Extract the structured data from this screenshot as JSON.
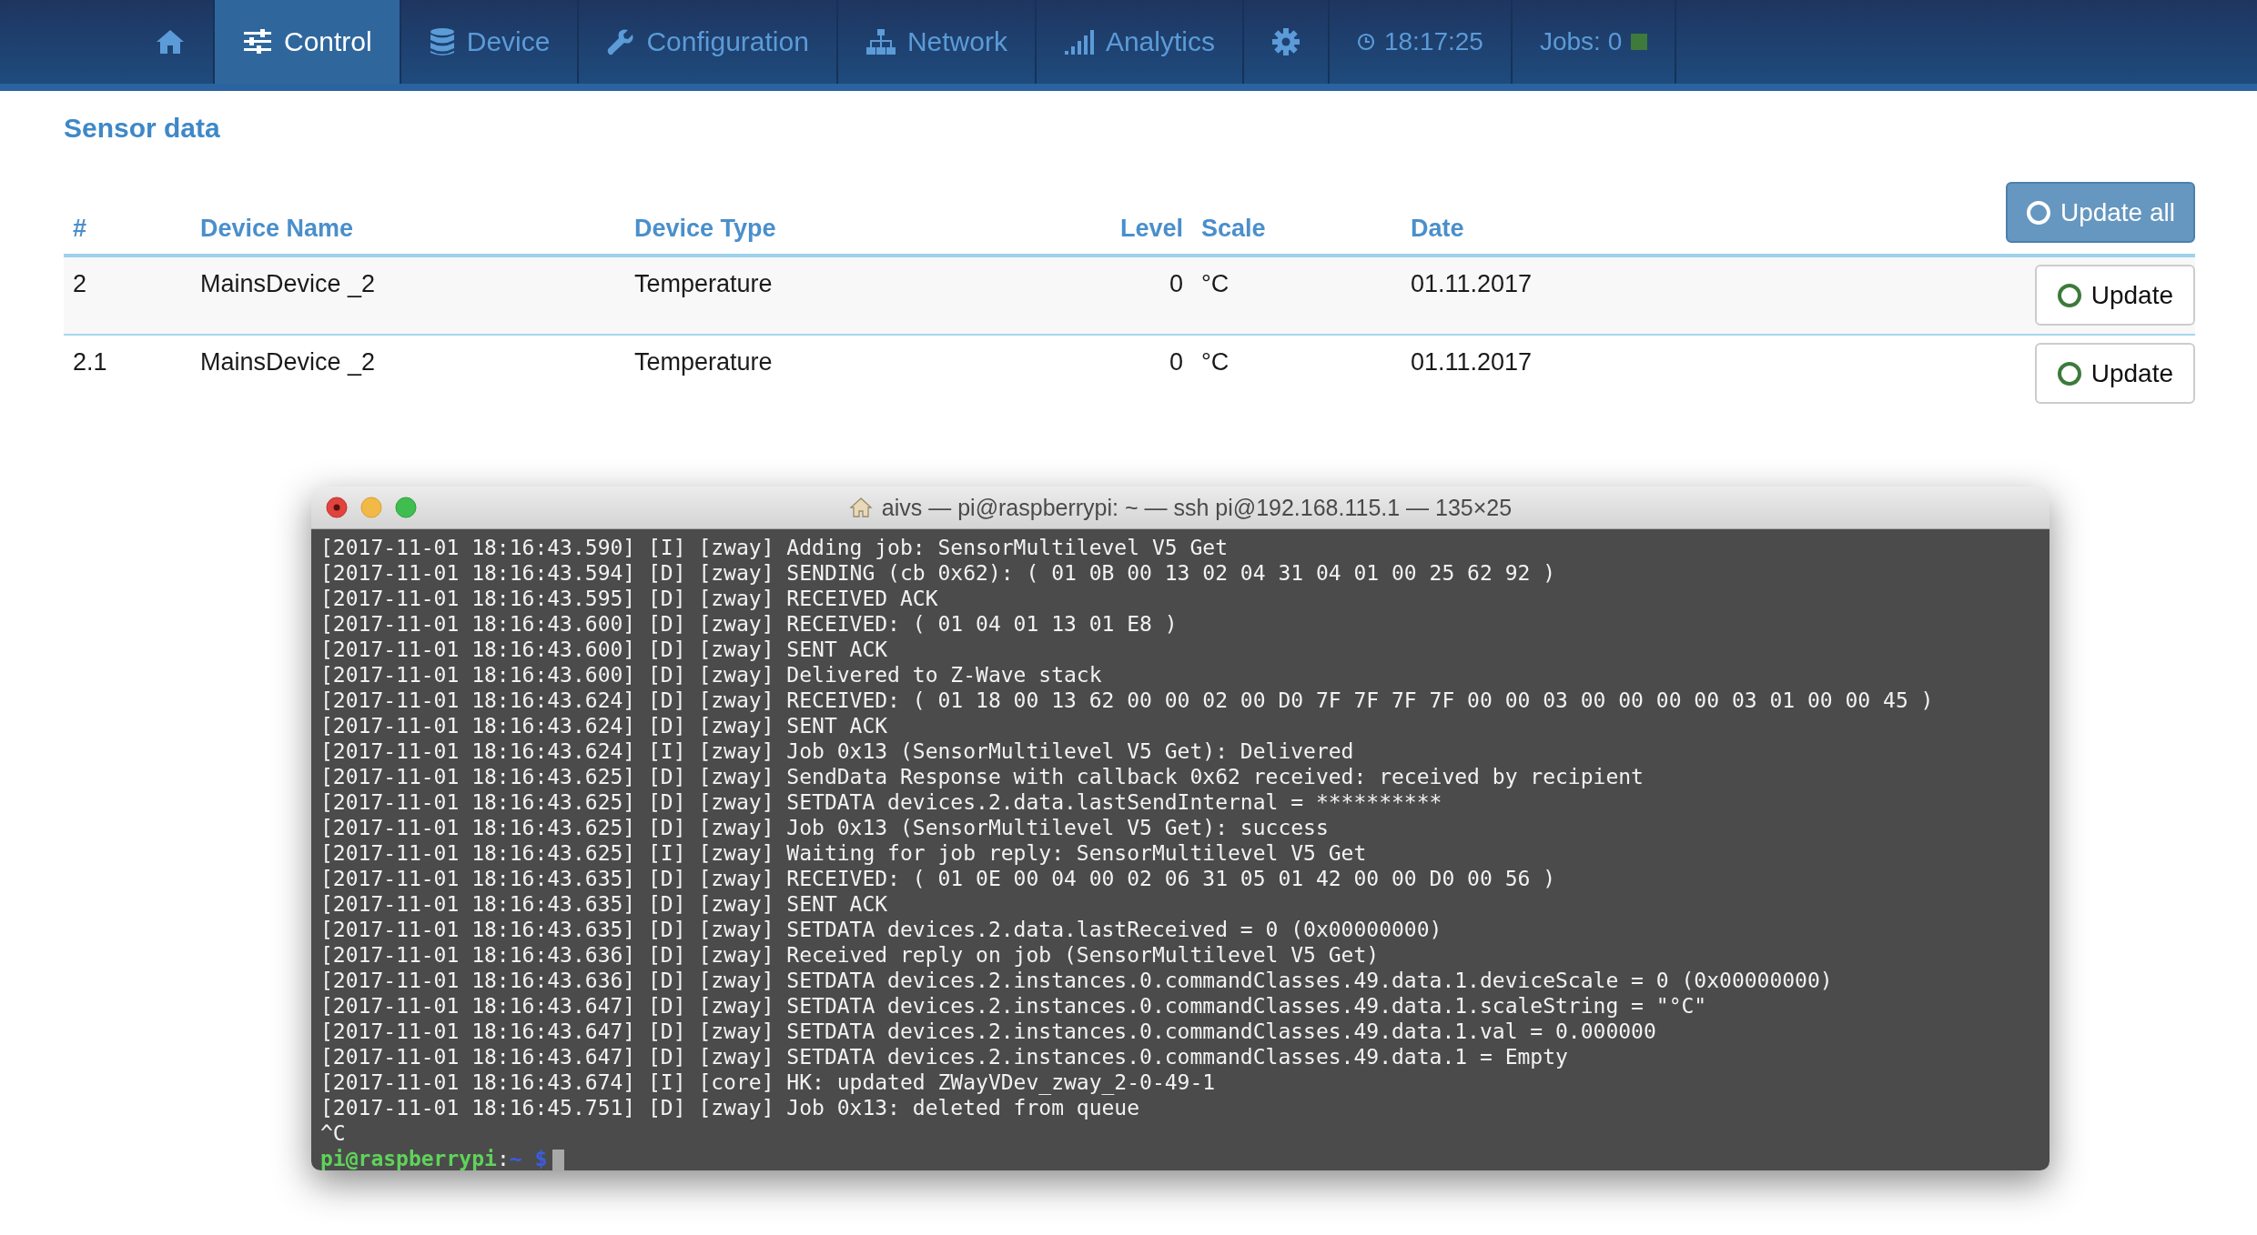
{
  "nav": {
    "tabs": [
      {
        "kind": "home",
        "selected": false
      },
      {
        "kind": "control",
        "label": "Control",
        "selected": true
      },
      {
        "kind": "device",
        "label": "Device",
        "selected": false
      },
      {
        "kind": "configuration",
        "label": "Configuration",
        "selected": false
      },
      {
        "kind": "network",
        "label": "Network",
        "selected": false
      },
      {
        "kind": "analytics",
        "label": "Analytics",
        "selected": false
      },
      {
        "kind": "settings",
        "selected": false
      }
    ],
    "clock": "18:17:25",
    "jobs": "Jobs: 0"
  },
  "sensor_data": {
    "title": "Sensor data",
    "update_all_button": "Update all",
    "columns": [
      "#",
      "Device Name",
      "Device Type",
      "Level",
      "Scale",
      "Date"
    ],
    "rows": [
      {
        "cells": [
          "2",
          "MainsDevice _2",
          "Temperature",
          "0",
          "°C",
          "01.11.2017"
        ],
        "button": "Update"
      },
      {
        "cells": [
          "2.1",
          "MainsDevice _2",
          "Temperature",
          "0",
          "°C",
          "01.11.2017"
        ],
        "button": "Update"
      }
    ]
  },
  "terminal": {
    "title": "aivs — pi@raspberrypi: ~ — ssh pi@192.168.115.1 — 135×25",
    "lines": [
      "[2017-11-01 18:16:43.590] [I] [zway] Adding job: SensorMultilevel V5 Get",
      "[2017-11-01 18:16:43.594] [D] [zway] SENDING (cb 0x62): ( 01 0B 00 13 02 04 31 04 01 00 25 62 92 )",
      "[2017-11-01 18:16:43.595] [D] [zway] RECEIVED ACK",
      "[2017-11-01 18:16:43.600] [D] [zway] RECEIVED: ( 01 04 01 13 01 E8 )",
      "[2017-11-01 18:16:43.600] [D] [zway] SENT ACK",
      "[2017-11-01 18:16:43.600] [D] [zway] Delivered to Z-Wave stack",
      "[2017-11-01 18:16:43.624] [D] [zway] RECEIVED: ( 01 18 00 13 62 00 00 02 00 D0 7F 7F 7F 7F 00 00 03 00 00 00 00 03 01 00 00 45 )",
      "[2017-11-01 18:16:43.624] [D] [zway] SENT ACK",
      "[2017-11-01 18:16:43.624] [I] [zway] Job 0x13 (SensorMultilevel V5 Get): Delivered",
      "[2017-11-01 18:16:43.625] [D] [zway] SendData Response with callback 0x62 received: received by recipient",
      "[2017-11-01 18:16:43.625] [D] [zway] SETDATA devices.2.data.lastSendInternal = **********",
      "[2017-11-01 18:16:43.625] [D] [zway] Job 0x13 (SensorMultilevel V5 Get): success",
      "[2017-11-01 18:16:43.625] [I] [zway] Waiting for job reply: SensorMultilevel V5 Get",
      "[2017-11-01 18:16:43.635] [D] [zway] RECEIVED: ( 01 0E 00 04 00 02 06 31 05 01 42 00 00 D0 00 56 )",
      "[2017-11-01 18:16:43.635] [D] [zway] SENT ACK",
      "[2017-11-01 18:16:43.635] [D] [zway] SETDATA devices.2.data.lastReceived = 0 (0x00000000)",
      "[2017-11-01 18:16:43.636] [D] [zway] Received reply on job (SensorMultilevel V5 Get)",
      "[2017-11-01 18:16:43.636] [D] [zway] SETDATA devices.2.instances.0.commandClasses.49.data.1.deviceScale = 0 (0x00000000)",
      "[2017-11-01 18:16:43.647] [D] [zway] SETDATA devices.2.instances.0.commandClasses.49.data.1.scaleString = \"°C\"",
      "[2017-11-01 18:16:43.647] [D] [zway] SETDATA devices.2.instances.0.commandClasses.49.data.1.val = 0.000000",
      "[2017-11-01 18:16:43.647] [D] [zway] SETDATA devices.2.instances.0.commandClasses.49.data.1 = Empty",
      "[2017-11-01 18:16:43.674] [I] [core] HK: updated ZWayVDev_zway_2-0-49-1",
      "[2017-11-01 18:16:45.751] [D] [zway] Job 0x13: deleted from queue",
      "^C"
    ],
    "prompt": {
      "user": "pi@raspberrypi",
      "separator": ":",
      "path": "~",
      "symbol": "$"
    }
  }
}
